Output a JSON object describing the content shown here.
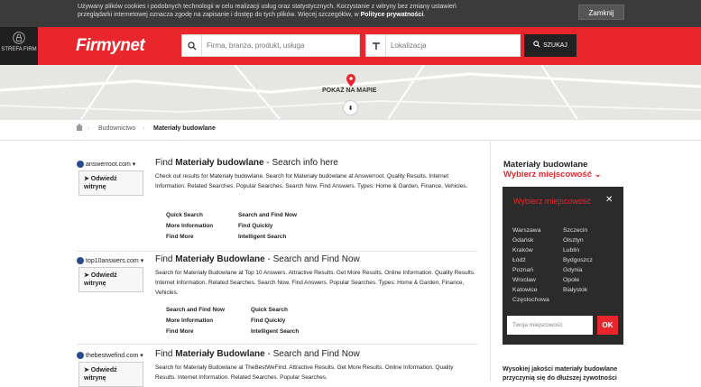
{
  "cookie": {
    "text_1": "Używany plików cookies i podobnych technologii w celu realizacji usług oraz statystycznych. Korzystanie z witryny bez zmiany ustawień przeglądarki internetowej oznacza zgodę na zapisanie i dostęp do tych plików. Więcej szczegółów, w ",
    "link": "Polityce prywatności",
    "text_2": ".",
    "close": "Zamknij"
  },
  "header": {
    "strefa": "STREFA FIRM",
    "logo": "Firmynet",
    "search_placeholder": "Firma, branża, produkt, usługa",
    "location_placeholder": "Lokalizacja",
    "search_button": "SZUKAJ"
  },
  "map": {
    "show": "POKAŻ NA MAPIE"
  },
  "breadcrumb": {
    "level1": "Budownictwo",
    "current": "Materiały budowlane"
  },
  "results": [
    {
      "source": "answerroot.com ▾",
      "visit": "➤ Odwiedź witrynę",
      "title_1": "Find ",
      "title_2": "Materiały budowlane",
      "title_3": " - Search info here",
      "desc": "Check out results for Materiały budowlane. Search for Materiały budowlane at Answerroot. Quality Results. Internet Information. Related Searches. Popular Searches. Search Now. Find Answers. Types: Home & Garden, Finance, Vehicles.",
      "links": [
        [
          "Quick Search",
          "Search and Find Now"
        ],
        [
          "More Information",
          "Find Quickly"
        ],
        [
          "Find More",
          "Intelligent Search"
        ]
      ]
    },
    {
      "source": "top10answers.com ▾",
      "visit": "➤ Odwiedź witrynę",
      "title_1": "Find ",
      "title_2": "Materiały Budowlane",
      "title_3": " - Search and Find Now",
      "desc": "Search for Materiały Budowlane at Top 10 Answers. Attractive Results. Get More Results. Online Information. Quality Results. Internet Information. Related Searches. Search Now. Find Answers. Popular Searches. Types: Home & Garden, Finance, Vehicles.",
      "links": [
        [
          "Search and Find Now",
          "Quick Search"
        ],
        [
          "More Information",
          "Find Quickly"
        ],
        [
          "Find More",
          "Intelligent Search"
        ]
      ]
    },
    {
      "source": "thebestwefind.com ▾",
      "visit": "➤ Odwiedź witrynę",
      "title_1": "Find ",
      "title_2": "Materiały Budowlane",
      "title_3": " - Search and Find Now",
      "desc": "Search for Materiały Budowlane at TheBestWeFind. Attractive Results. Get More Results. Online Information. Quality Results. Internet Information. Related Searches. Popular Searches.",
      "links": []
    }
  ],
  "sidebar": {
    "title": "Materiały budowlane",
    "city_select": "Wybierz miejscowość ⌄",
    "box_title": "Wybierz miejscowość",
    "close": "✕",
    "cities_left": [
      "Warszawa",
      "Gdańsk",
      "Kraków",
      "Łódź",
      "Poznań",
      "Wrocław",
      "Katowice",
      "Częstochowa"
    ],
    "cities_right": [
      "Szczecin",
      "Olsztyn",
      "Lublin",
      "Bydgoszcz",
      "Gdynia",
      "Opole",
      "Białystok"
    ],
    "input_placeholder": "Twoja miejscowość",
    "ok": "OK",
    "bottom": "Wysokiej jakości materiały budowlane przyczynią się do dłuższej żywotności"
  }
}
